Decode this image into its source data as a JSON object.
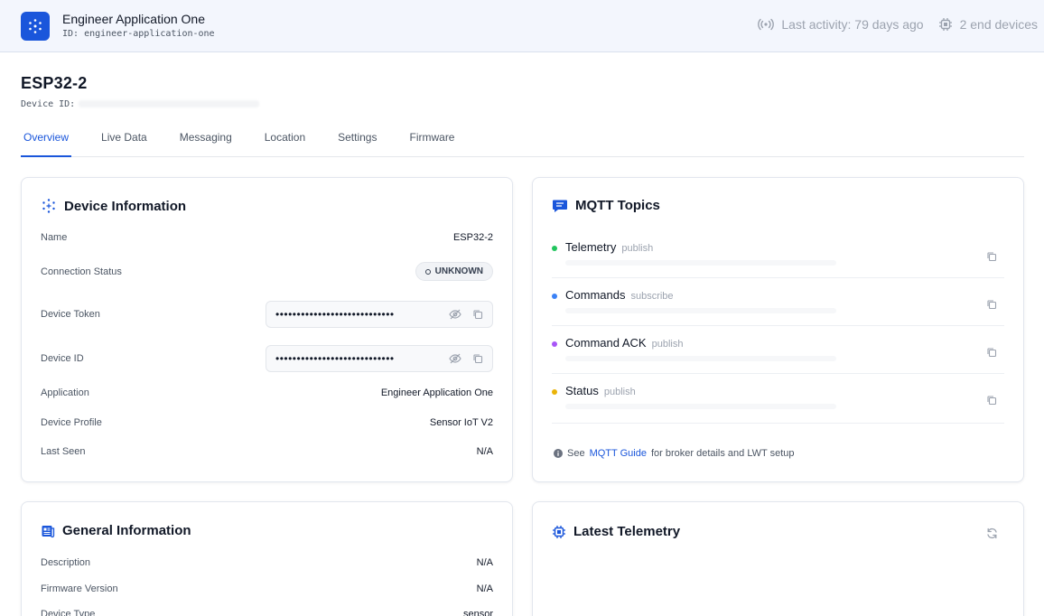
{
  "app": {
    "name": "Engineer Application One",
    "id": "ID: engineer-application-one",
    "last_activity": "Last activity: 79 days ago",
    "end_devices": "2 end devices"
  },
  "device": {
    "title": "ESP32-2",
    "id_label": "Device ID:"
  },
  "tabs": [
    {
      "label": "Overview",
      "active": true
    },
    {
      "label": "Live Data"
    },
    {
      "label": "Messaging"
    },
    {
      "label": "Location"
    },
    {
      "label": "Settings"
    },
    {
      "label": "Firmware"
    }
  ],
  "device_info": {
    "title": "Device Information",
    "name_label": "Name",
    "name_value": "ESP32-2",
    "status_label": "Connection Status",
    "status_value": "UNKNOWN",
    "token_label": "Device Token",
    "token_value": "••••••••••••••••••••••••••••",
    "deviceid_label": "Device ID",
    "deviceid_value": "••••••••••••••••••••••••••••",
    "application_label": "Application",
    "application_value": "Engineer Application One",
    "profile_label": "Device Profile",
    "profile_value": "Sensor IoT V2",
    "lastseen_label": "Last Seen",
    "lastseen_value": "N/A"
  },
  "mqtt": {
    "title": "MQTT Topics",
    "topics": [
      {
        "name": "Telemetry",
        "mode": "publish",
        "color": "#22c55e"
      },
      {
        "name": "Commands",
        "mode": "subscribe",
        "color": "#3b82f6"
      },
      {
        "name": "Command ACK",
        "mode": "publish",
        "color": "#a855f7"
      },
      {
        "name": "Status",
        "mode": "publish",
        "color": "#eab308"
      }
    ],
    "guide_prefix": "See",
    "guide_link": "MQTT Guide",
    "guide_suffix": "for broker details and LWT setup"
  },
  "general_info": {
    "title": "General Information",
    "description_label": "Description",
    "description_value": "N/A",
    "firmware_label": "Firmware Version",
    "firmware_value": "N/A",
    "type_label": "Device Type",
    "type_value": "sensor"
  },
  "telemetry": {
    "title": "Latest Telemetry"
  },
  "colors": {
    "accent": "#1a56db",
    "appbar_bg": "#f3f6fd"
  }
}
